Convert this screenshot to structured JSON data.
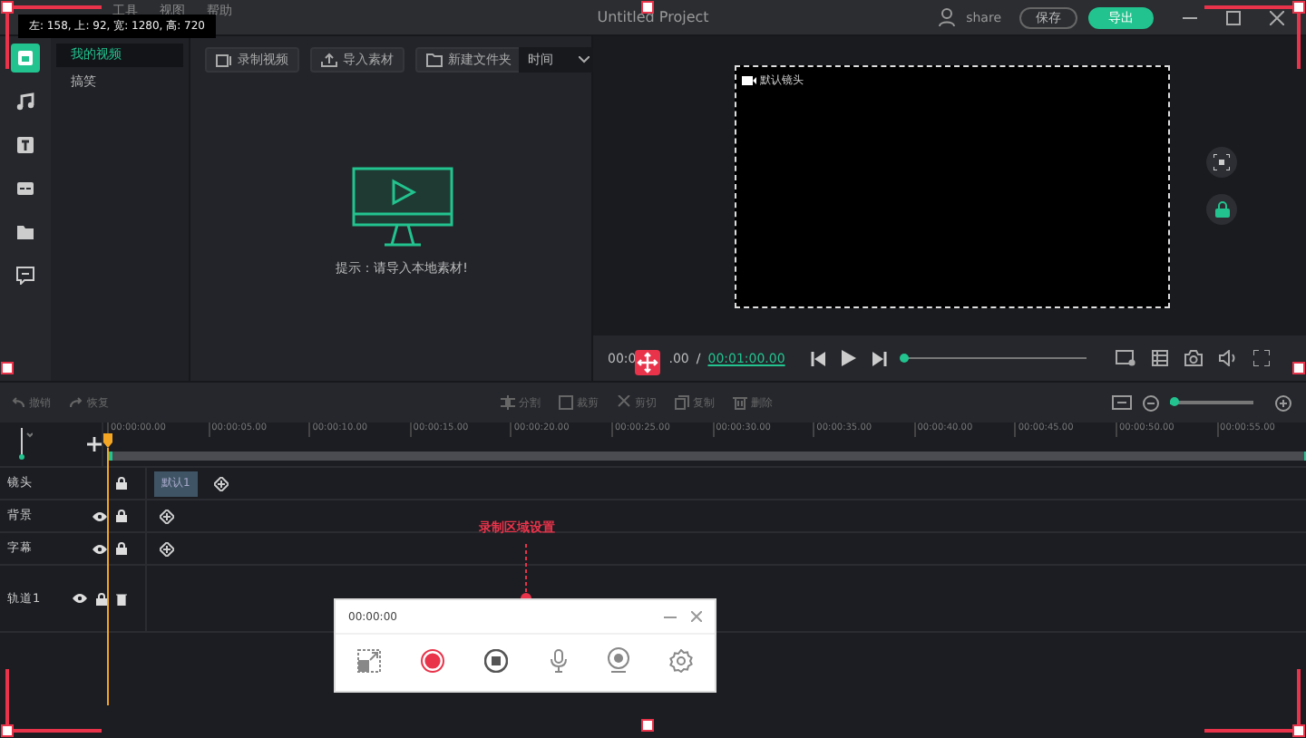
{
  "region_tooltip": "左: 158, 上: 92, 宽: 1280, 高: 720",
  "menu": [
    "工具",
    "视图",
    "帮助"
  ],
  "window": {
    "title": "Untitled Project"
  },
  "account": {
    "label": "share"
  },
  "header_buttons": [
    {
      "label": "保存",
      "kind": "outline"
    },
    {
      "label": "导出",
      "kind": "primary"
    }
  ],
  "rail": [
    {
      "kind": "media",
      "selected": true
    },
    {
      "kind": "music",
      "selected": false
    },
    {
      "kind": "text",
      "selected": false
    },
    {
      "kind": "subtitle",
      "selected": false
    },
    {
      "kind": "folder",
      "selected": false
    },
    {
      "kind": "comment",
      "selected": false
    }
  ],
  "library": [
    {
      "label": "我的视频",
      "selected": true
    },
    {
      "label": "搞笑",
      "selected": false
    }
  ],
  "media_toolbar": {
    "buttons": [
      {
        "label": "录制视频",
        "kind": "record"
      },
      {
        "label": "导入素材",
        "kind": "import"
      },
      {
        "label": "新建文件夹",
        "kind": "folder"
      }
    ],
    "sort": "时间"
  },
  "empty_hint": "提示：请导入本地素材!",
  "preview": {
    "camera_label": "默认镜头",
    "current_time": [
      "00:0",
      ".00"
    ],
    "separator": "/",
    "total_time": "00:01:00.00",
    "progress": {
      "level": 0
    }
  },
  "history": [
    {
      "label": "撤销",
      "disabled": true
    },
    {
      "label": "恢复",
      "disabled": true
    }
  ],
  "edit_tools": [
    {
      "label": "分割",
      "kind": "split",
      "disabled": true
    },
    {
      "label": "裁剪",
      "kind": "crop",
      "disabled": true
    },
    {
      "label": "剪切",
      "kind": "cut",
      "disabled": true
    },
    {
      "label": "复制",
      "kind": "copy",
      "disabled": true
    },
    {
      "label": "删除",
      "kind": "delete",
      "disabled": true
    }
  ],
  "zoom": {
    "level": 0.05
  },
  "ruler": [
    "00:00:00.00",
    "00:00:05.00",
    "00:00:10.00",
    "00:00:15.00",
    "00:00:20.00",
    "00:00:25.00",
    "00:00:30.00",
    "00:00:35.00",
    "00:00:40.00",
    "00:00:45.00",
    "00:00:50.00",
    "00:00:55.00"
  ],
  "tracks": [
    {
      "name": "镜头",
      "controls": [
        {
          "kind": "lock"
        }
      ],
      "clips": [
        {
          "label": "默认1"
        }
      ]
    },
    {
      "name": "背景",
      "controls": [
        {
          "kind": "eye"
        },
        {
          "kind": "lock"
        }
      ]
    },
    {
      "name": "字幕",
      "controls": [
        {
          "kind": "eye"
        },
        {
          "kind": "lock"
        }
      ]
    },
    {
      "name": "轨道1",
      "controls": [
        {
          "kind": "eye"
        },
        {
          "kind": "lock"
        },
        {
          "kind": "trash"
        }
      ]
    }
  ],
  "annotation": "录制区域设置",
  "recorder": {
    "time": "00:00:00",
    "tools": [
      {
        "kind": "region"
      },
      {
        "kind": "record"
      },
      {
        "kind": "stop"
      },
      {
        "kind": "mic"
      },
      {
        "kind": "webcam"
      },
      {
        "kind": "settings"
      }
    ]
  }
}
